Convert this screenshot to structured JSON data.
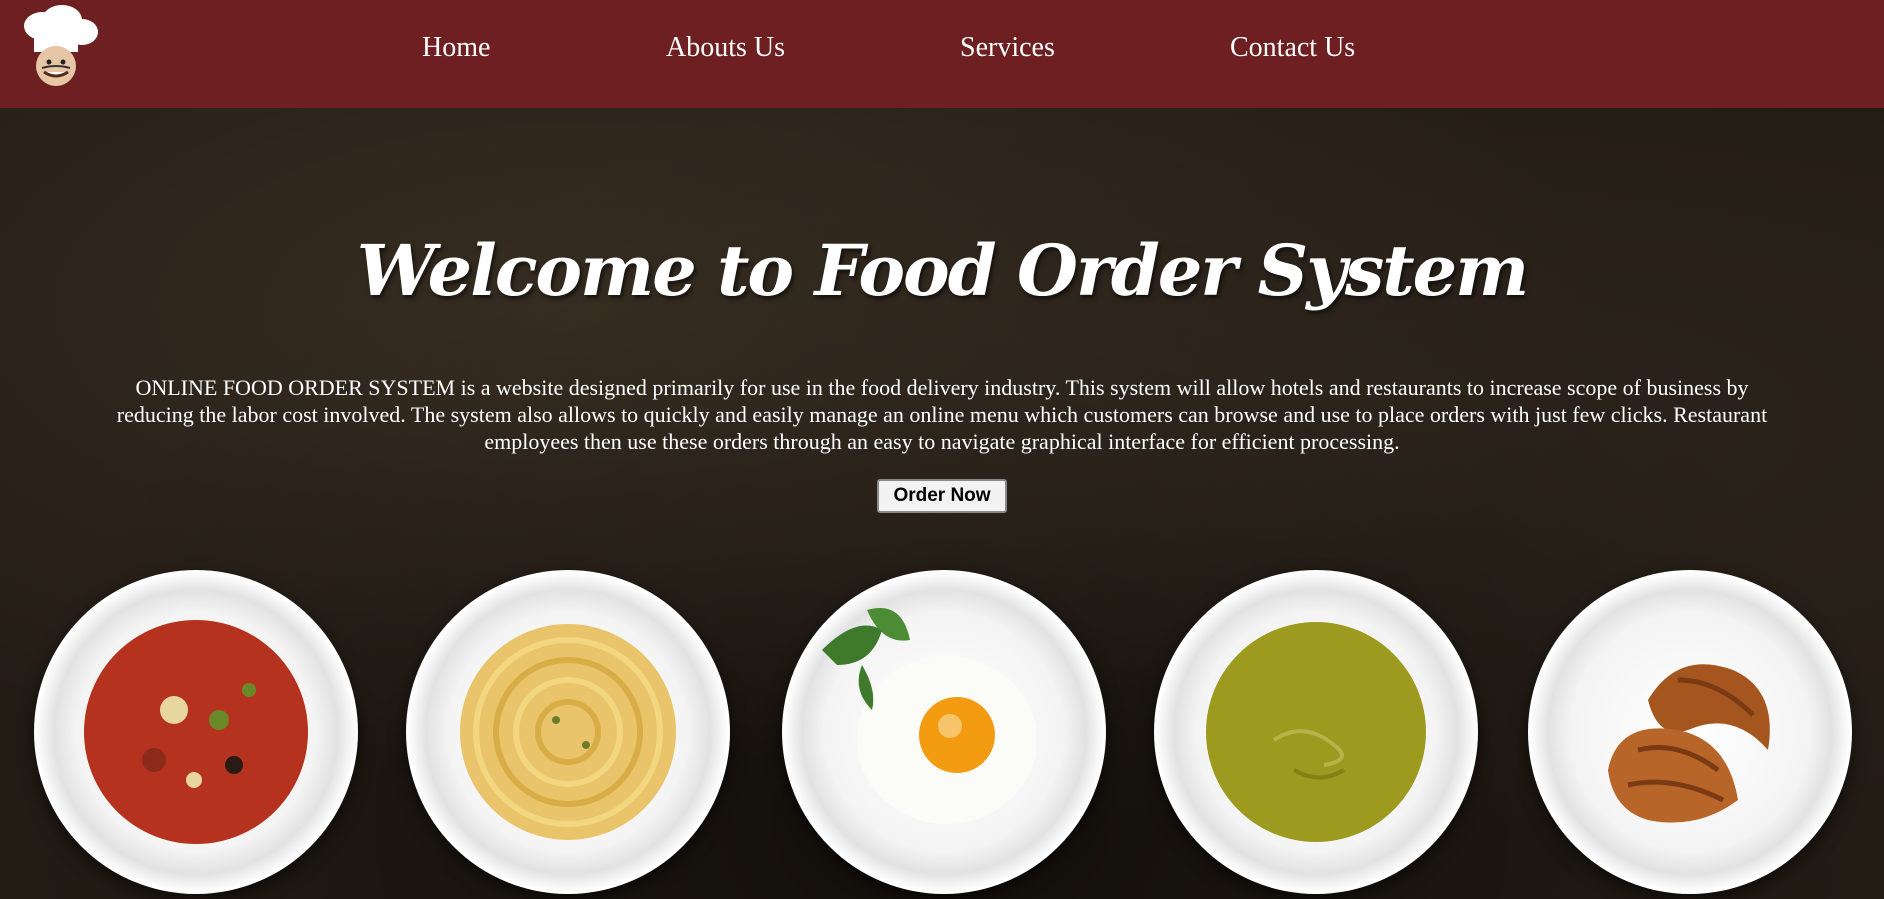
{
  "nav": {
    "logo": "chef-logo",
    "links": [
      "Home",
      "Abouts Us",
      "Services",
      "Contact Us"
    ]
  },
  "hero": {
    "title": "Welcome to Food Order System",
    "description": "ONLINE FOOD ORDER SYSTEM is a website designed primarily for use in the food delivery industry. This system will allow hotels and restaurants to increase scope of business by reducing the labor cost involved. The system also allows to quickly and easily manage an online menu which customers can browse and use to place orders with just few clicks. Restaurant employees then use these orders through an easy to navigate graphical interface for efficient processing.",
    "button": "Order Now"
  },
  "plates": [
    "vegetable-soup",
    "spaghetti",
    "fried-egg",
    "pea-soup",
    "croissants"
  ],
  "colors": {
    "navbar": "#6e1f21",
    "background": "#231c15",
    "text": "#ffffff"
  }
}
